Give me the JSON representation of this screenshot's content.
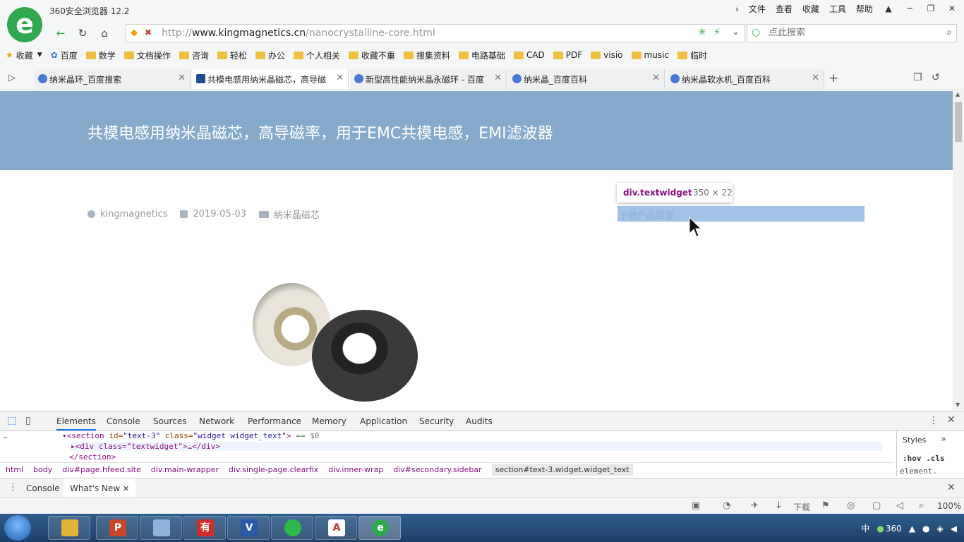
{
  "app": {
    "title": "360安全浏览器 12.2",
    "menu": [
      "文件",
      "查看",
      "收藏",
      "工具",
      "帮助"
    ]
  },
  "address": {
    "prefix": "http://",
    "domain": "www.kingmagnetics.cn",
    "path": "/nanocrystalline-core.html"
  },
  "search": {
    "placeholder": "点此搜索"
  },
  "bookmarks": [
    "收藏",
    "百度",
    "数学",
    "文档操作",
    "咨询",
    "轻松",
    "办公",
    "个人相关",
    "收藏不重",
    "搜集资料",
    "电路基础",
    "CAD",
    "PDF",
    "visio",
    "music",
    "临时"
  ],
  "tabs": [
    {
      "label": "纳米晶环_百度搜索"
    },
    {
      "label": "共模电感用纳米晶磁芯，高导磁"
    },
    {
      "label": "新型高性能纳米晶永磁环 - 百度"
    },
    {
      "label": "纳米晶_百度百科"
    },
    {
      "label": "纳米晶软水机_百度百科"
    }
  ],
  "page": {
    "hero_title": "共模电感用纳米晶磁芯，高导磁率，用于EMC共模电感，EMI滤波器",
    "author": "kingmagnetics",
    "date": "2019-05-03",
    "category": "纳米晶磁芯",
    "widget_text": "下载产品目录"
  },
  "inspector": {
    "tooltip_name": "div.textwidget",
    "tooltip_size": "350 × 22"
  },
  "devtools": {
    "tabs": [
      "Elements",
      "Console",
      "Sources",
      "Network",
      "Performance",
      "Memory",
      "Application",
      "Security",
      "Audits"
    ],
    "code": {
      "line1_tag": "<section",
      "line1_attr1": " id=",
      "line1_val1": "\"text-3\"",
      "line1_attr2": " class=",
      "line1_val2": "\"widget widget_text\"",
      "line1_end": ">",
      "line1_eq": " == $0",
      "line2": "▸<div class=\"textwidget\">…</div>",
      "line3": "</section>"
    },
    "breadcrumbs": [
      "html",
      "body",
      "div#page.hfeed.site",
      "div.main-wrapper",
      "div.single-page.clearfix",
      "div.inner-wrap",
      "div#secondary.sidebar",
      "section#text-3.widget.widget_text"
    ],
    "styles_tab": "Styles",
    "styles_filter": ":hov .cls",
    "styles_element": "element.",
    "drawer_tabs": [
      "Console",
      "What's New"
    ]
  },
  "statusbar": {
    "download_label": "下载",
    "zoom": "100%"
  },
  "taskbar": {
    "tray_360": "360",
    "ime": "中"
  }
}
